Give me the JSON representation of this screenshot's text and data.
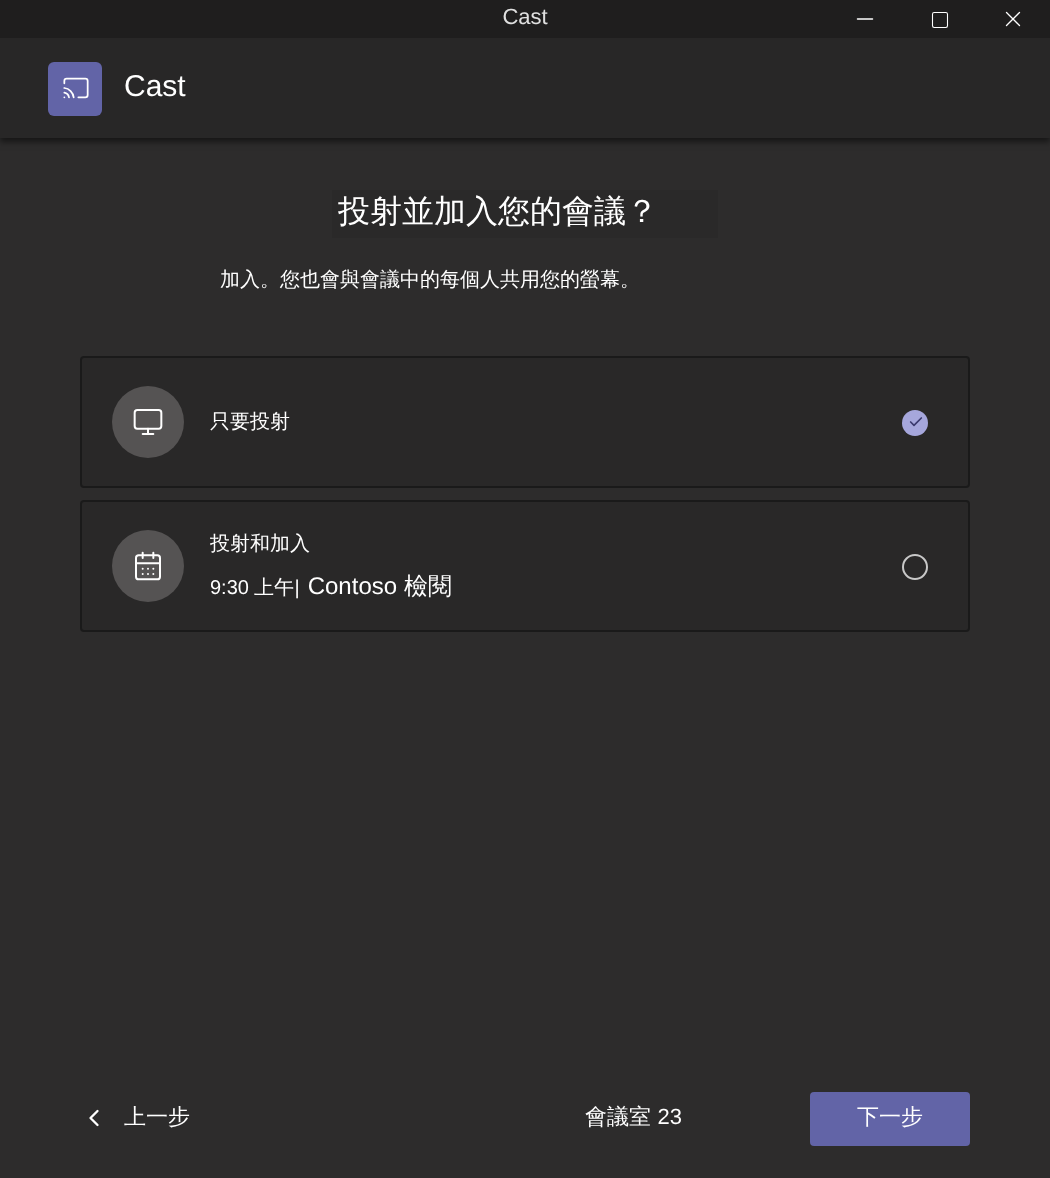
{
  "window": {
    "title": "Cast"
  },
  "header": {
    "title": "Cast"
  },
  "heading": "投射並加入您的會議？",
  "description": "加入。您也會與會議中的每個人共用您的螢幕。",
  "options": [
    {
      "kind": "screen",
      "label": "只要投射",
      "selected": true
    },
    {
      "kind": "meeting",
      "label": "投射和加入",
      "time": "9:30 上午|",
      "meeting": "Contoso 檢閱",
      "selected": false
    }
  ],
  "footer": {
    "back": "上一步",
    "room": "會議室 23",
    "next": "下一步"
  }
}
